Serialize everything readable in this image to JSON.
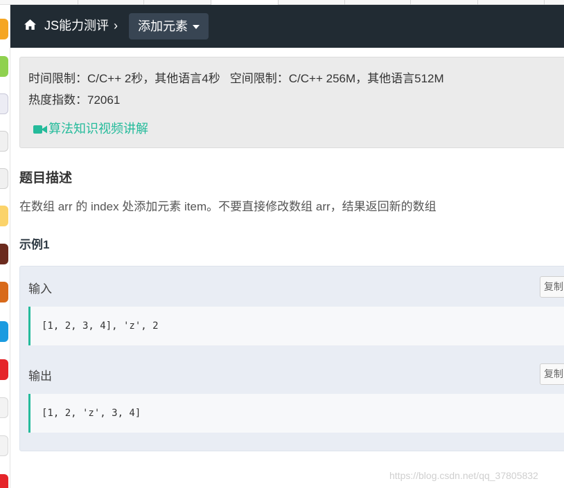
{
  "colors": {
    "header_bg": "#212b33",
    "dropdown_bg": "#384553",
    "accent_green": "#25bb9b",
    "limits_bg": "#ebebeb",
    "example_bg": "#e9edf4"
  },
  "header": {
    "home_icon": "home-icon",
    "breadcrumb": "JS能力测评",
    "separator": "›",
    "title": "添加元素"
  },
  "limits": {
    "time": "时间限制：C/C++ 2秒，其他语言4秒",
    "space": "空间限制：C/C++ 256M，其他语言512M",
    "heat": "热度指数：72061",
    "video_icon": "video-camera-icon",
    "video_link": "算法知识视频讲解"
  },
  "problem": {
    "section_title": "题目描述",
    "description": "在数组 arr 的 index 处添加元素 item。不要直接修改数组 arr，结果返回新的数组",
    "example_title": "示例1"
  },
  "example": {
    "input_label": "输入",
    "input_value": "[1, 2, 3, 4], 'z', 2",
    "output_label": "输出",
    "output_value": "[1, 2, 'z', 3, 4]",
    "copy_label": "复制"
  },
  "watermark": "https://blog.csdn.net/qq_37805832"
}
